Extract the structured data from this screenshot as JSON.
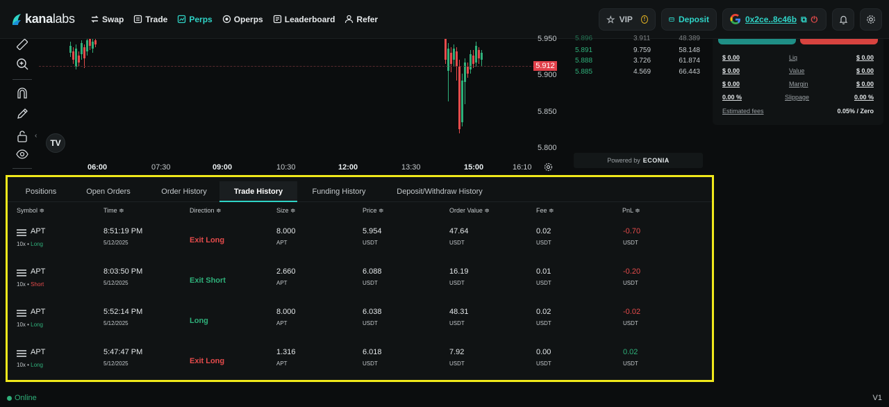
{
  "brand": {
    "name_bold": "kana",
    "name_rest": "labs"
  },
  "nav": {
    "items": [
      {
        "label": "Swap",
        "icon": "swap-icon"
      },
      {
        "label": "Trade",
        "icon": "trade-icon"
      },
      {
        "label": "Perps",
        "icon": "perps-icon",
        "active": true
      },
      {
        "label": "Operps",
        "icon": "operps-icon"
      },
      {
        "label": "Leaderboard",
        "icon": "leaderboard-icon"
      },
      {
        "label": "Refer",
        "icon": "refer-icon"
      }
    ],
    "vip_label": "VIP",
    "deposit_label": "Deposit",
    "wallet_address": "0x2ce..8c46b"
  },
  "chart": {
    "last_price": "5.912",
    "y_ticks": [
      "5.950",
      "5.900",
      "5.850",
      "5.800"
    ],
    "x_ticks": [
      "06:00",
      "07:30",
      "09:00",
      "10:30",
      "12:00",
      "13:30",
      "15:00",
      "16:10"
    ]
  },
  "orderbook": {
    "rows": [
      {
        "price": "5.896",
        "size": "3.911",
        "total": "48.389"
      },
      {
        "price": "5.891",
        "size": "9.759",
        "total": "58.148"
      },
      {
        "price": "5.888",
        "size": "3.726",
        "total": "61.874"
      },
      {
        "price": "5.885",
        "size": "4.569",
        "total": "66.443"
      }
    ],
    "powered_by": "Powered by",
    "powered_brand": "ECONIA"
  },
  "order_panel": {
    "rows": [
      {
        "left": "$ 0.00",
        "label": "Liq",
        "right": "$ 0.00"
      },
      {
        "left": "$ 0.00",
        "label": "Value",
        "right": "$ 0.00"
      },
      {
        "left": "$ 0.00",
        "label": "Margin",
        "right": "$ 0.00"
      },
      {
        "left": "0.00 %",
        "label": "Slippage",
        "right": "0.00 %"
      }
    ],
    "fees_label": "Estimated fees",
    "fees_value": "0.05% / Zero"
  },
  "history": {
    "tabs": [
      "Positions",
      "Open Orders",
      "Order History",
      "Trade History",
      "Funding History",
      "Deposit/Withdraw History"
    ],
    "active_tab": "Trade History",
    "columns": [
      "Symbol ≑",
      "Time ≑",
      "Direction ≑",
      "Size ≑",
      "Price ≑",
      "Order Value ≑",
      "Fee ≑",
      "PnL ≑"
    ],
    "rows": [
      {
        "symbol": "APT",
        "leverage": "10x • ",
        "side": "Long",
        "time": "8:51:19 PM",
        "date": "5/12/2025",
        "direction": "Exit Long",
        "size": "8.000",
        "size_unit": "APT",
        "price": "5.954",
        "price_unit": "USDT",
        "value": "47.64",
        "value_unit": "USDT",
        "fee": "0.02",
        "fee_unit": "USDT",
        "pnl": "-0.70",
        "pnl_unit": "USDT"
      },
      {
        "symbol": "APT",
        "leverage": "10x • ",
        "side": "Short",
        "time": "8:03:50 PM",
        "date": "5/12/2025",
        "direction": "Exit Short",
        "size": "2.660",
        "size_unit": "APT",
        "price": "6.088",
        "price_unit": "USDT",
        "value": "16.19",
        "value_unit": "USDT",
        "fee": "0.01",
        "fee_unit": "USDT",
        "pnl": "-0.20",
        "pnl_unit": "USDT"
      },
      {
        "symbol": "APT",
        "leverage": "10x • ",
        "side": "Long",
        "time": "5:52:14 PM",
        "date": "5/12/2025",
        "direction": "Long",
        "size": "8.000",
        "size_unit": "APT",
        "price": "6.038",
        "price_unit": "USDT",
        "value": "48.31",
        "value_unit": "USDT",
        "fee": "0.02",
        "fee_unit": "USDT",
        "pnl": "-0.02",
        "pnl_unit": "USDT"
      },
      {
        "symbol": "APT",
        "leverage": "10x • ",
        "side": "Long",
        "time": "5:47:47 PM",
        "date": "5/12/2025",
        "direction": "Exit Long",
        "size": "1.316",
        "size_unit": "APT",
        "price": "6.018",
        "price_unit": "USDT",
        "value": "7.92",
        "value_unit": "USDT",
        "fee": "0.00",
        "fee_unit": "USDT",
        "pnl": "0.02",
        "pnl_unit": "USDT"
      }
    ]
  },
  "status": {
    "online": "Online",
    "version": "V1"
  },
  "colors": {
    "accent": "#2fd3c6",
    "buy": "#2fb07a",
    "sell": "#e54b4b",
    "highlight": "#f0e81b"
  }
}
